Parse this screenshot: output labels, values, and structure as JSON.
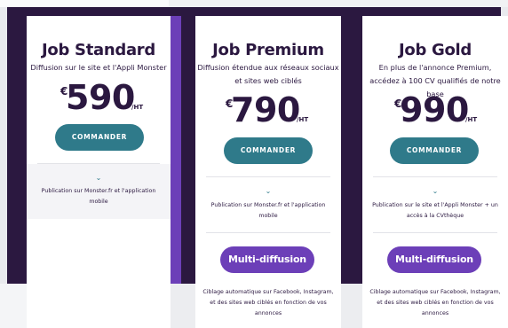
{
  "plans": [
    {
      "title": "Job Standard",
      "description": "Diffusion sur le site et l'Appli Monster",
      "currency": "€",
      "amount": "590",
      "unit": "/HT",
      "cta": "COMMANDER",
      "chevron_icon": "chevron-down-icon",
      "feature": "Publication sur Monster.fr et l'application mobile"
    },
    {
      "title": "Job Premium",
      "description": "Diffusion étendue aux réseaux sociaux et sites web ciblés",
      "currency": "€",
      "amount": "790",
      "unit": "/HT",
      "cta": "COMMANDER",
      "chevron_icon": "chevron-down-icon",
      "feature": "Publication sur Monster.fr et l'application mobile",
      "extra_label": "Multi-diffusion",
      "extra_text": "Ciblage automatique sur Facebook, Instagram, et des sites web ciblés en fonction de vos annonces"
    },
    {
      "title": "Job Gold",
      "description": "En plus de l'annonce Premium, accédez à 100 CV qualifiés de notre base",
      "currency": "€",
      "amount": "990",
      "unit": "/HT",
      "cta": "COMMANDER",
      "chevron_icon": "chevron-down-icon",
      "feature": "Publication sur le site et l'Appli Monster + un accès à la CVthèque",
      "extra_label": "Multi-diffusion",
      "extra_text": "Ciblage automatique sur Facebook, Instagram, et des sites web ciblés en fonction de vos annonces"
    }
  ],
  "colors": {
    "brand_dark": "#2b1840",
    "brand_purple": "#6c3fb8",
    "cta_teal": "#2f7a8a"
  }
}
